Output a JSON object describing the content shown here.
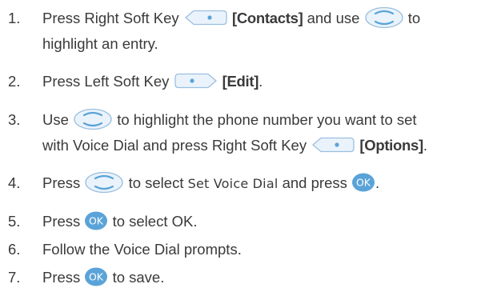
{
  "steps": [
    {
      "num": "1.",
      "t1": "Press Right Soft Key",
      "b1": "[Contacts]",
      "t2": "and use",
      "t3": "to",
      "t4": "highlight an entry."
    },
    {
      "num": "2.",
      "t1": "Press Left Soft Key",
      "b1": "[Edit]",
      "t2": "."
    },
    {
      "num": "3.",
      "t1": "Use",
      "t2": "to highlight the phone number you want to set",
      "t3": "with Voice Dial and press Right Soft Key",
      "b1": "[Options]",
      "t4": "."
    },
    {
      "num": "4.",
      "t1": "Press",
      "t2": "to select",
      "ui": "Set Voice Dial",
      "t3": "and press",
      "t4": "."
    },
    {
      "num": "5.",
      "t1": "Press",
      "t2": "to select OK."
    },
    {
      "num": "6.",
      "t1": "Follow the Voice Dial prompts."
    },
    {
      "num": "7.",
      "t1": "Press",
      "t2": "to save."
    }
  ],
  "icons": {
    "ok_label": "OK",
    "ok_color": "#5aa3d8",
    "key_fill": "#eaf3fb",
    "key_stroke": "#9bbfdf",
    "dot_color": "#5aa3d8"
  }
}
